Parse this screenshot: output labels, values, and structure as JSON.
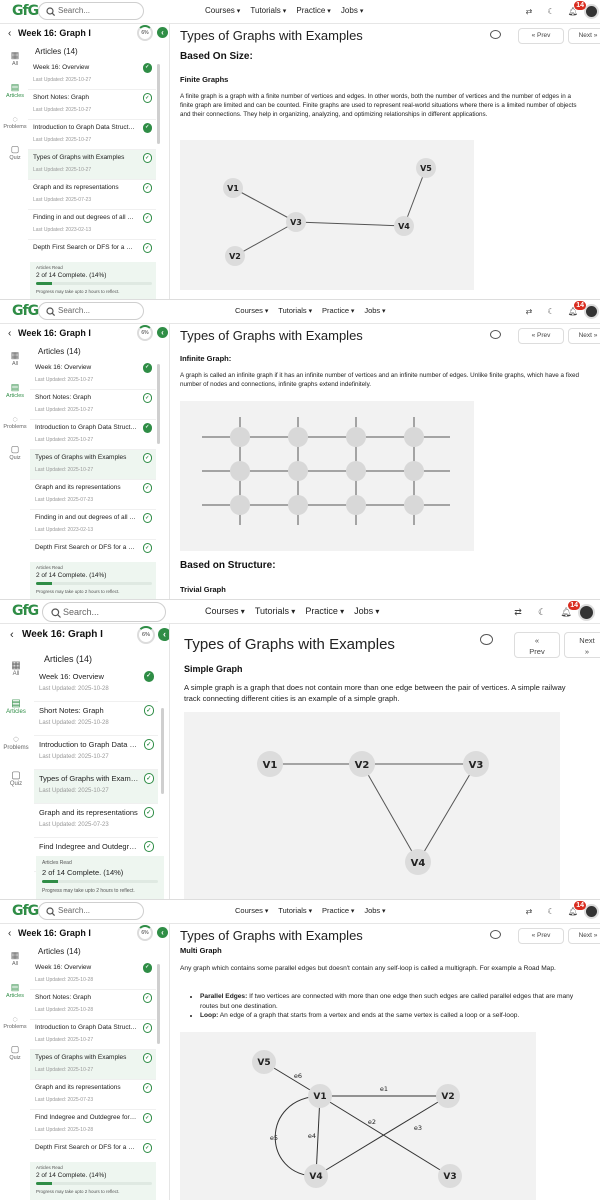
{
  "header": {
    "logo": "GfG",
    "search_placeholder": "Search...",
    "nav": [
      "Courses",
      "Tutorials",
      "Practice",
      "Jobs"
    ],
    "notif_count": "14"
  },
  "sidebar": {
    "week_title": "Week 16: Graph I",
    "percent": "6%",
    "rail": [
      "All",
      "Articles",
      "Problems",
      "Quiz"
    ],
    "articles_heading": "Articles (14)",
    "progress_label": "Articles Read",
    "progress_value": "2 of 14 Complete. (14%)",
    "progress_fraction": 0.14,
    "progress_note": "Progress may take upto 2 hours to reflect."
  },
  "panels": [
    {
      "articles": [
        {
          "title": "Week 16: Overview",
          "updated": "Last Updated: 2025-10-27",
          "done": true,
          "selected": false
        },
        {
          "title": "Short Notes: Graph",
          "updated": "Last Updated: 2025-10-27",
          "done": false,
          "selected": false
        },
        {
          "title": "Introduction to Graph Data Structure",
          "updated": "Last Updated: 2025-10-27",
          "done": true,
          "selected": false
        },
        {
          "title": "Types of Graphs with Examples",
          "updated": "Last Updated: 2025-10-27",
          "done": false,
          "selected": true
        },
        {
          "title": "Graph and its representations",
          "updated": "Last Updated: 2025-07-23",
          "done": false,
          "selected": false
        },
        {
          "title": "Finding in and out degrees of all ver...",
          "updated": "Last Updated: 2023-02-13",
          "done": false,
          "selected": false
        },
        {
          "title": "Depth First Search or DFS for a Gra...",
          "updated": "",
          "done": false,
          "selected": false
        }
      ],
      "page_title": "Types of Graphs with Examples",
      "prev": "Prev",
      "next": "Next",
      "heading": "Based On Size:",
      "subheading": "Finite Graphs",
      "paragraph": "A finite graph is a graph with a finite number of vertices and edges. In other words, both the number of vertices and the number of edges in a finite graph are limited and can be counted. Finite graphs are used to represent real-world situations where there is a limited number of objects and their connections. They help in organizing, analyzing, and optimizing relationships in different applications.",
      "labels": [
        "V1",
        "V2",
        "V3",
        "V4",
        "V5"
      ]
    },
    {
      "articles": [
        {
          "title": "Week 16: Overview",
          "updated": "Last Updated: 2025-10-27",
          "done": true,
          "selected": false
        },
        {
          "title": "Short Notes: Graph",
          "updated": "Last Updated: 2025-10-27",
          "done": false,
          "selected": false
        },
        {
          "title": "Introduction to Graph Data Structure",
          "updated": "Last Updated: 2025-10-27",
          "done": true,
          "selected": false
        },
        {
          "title": "Types of Graphs with Examples",
          "updated": "Last Updated: 2025-10-27",
          "done": false,
          "selected": true
        },
        {
          "title": "Graph and its representations",
          "updated": "Last Updated: 2025-07-23",
          "done": false,
          "selected": false
        },
        {
          "title": "Finding in and out degrees of all ver...",
          "updated": "Last Updated: 2023-02-13",
          "done": false,
          "selected": false
        },
        {
          "title": "Depth First Search or DFS for a Gra...",
          "updated": "",
          "done": false,
          "selected": false
        }
      ],
      "page_title": "Types of Graphs with Examples",
      "prev": "Prev",
      "next": "Next",
      "subheading": "Infinite Graph:",
      "paragraph": "A graph is called an infinite graph if it has an infinite number of vertices and an infinite number of edges. Unlike finite graphs, which have a fixed number of nodes and connections, infinite graphs extend indefinitely.",
      "heading2": "Based on Structure:",
      "subheading2": "Trivial Graph"
    },
    {
      "articles": [
        {
          "title": "Week 16: Overview",
          "updated": "Last Updated: 2025-10-28",
          "done": true,
          "selected": false
        },
        {
          "title": "Short Notes: Graph",
          "updated": "Last Updated: 2025-10-28",
          "done": false,
          "selected": false
        },
        {
          "title": "Introduction to Graph Data Str...",
          "updated": "Last Updated: 2025-10-27",
          "done": false,
          "selected": false
        },
        {
          "title": "Types of Graphs with Examples",
          "updated": "Last Updated: 2025-10-27",
          "done": false,
          "selected": true
        },
        {
          "title": "Graph and its representations",
          "updated": "Last Updated: 2025-07-23",
          "done": false,
          "selected": false
        },
        {
          "title": "Find Indegree and Outdegree ...",
          "updated": "",
          "done": false,
          "selected": false
        }
      ],
      "page_title": "Types of Graphs with Examples",
      "prev": "Prev",
      "next": "Next",
      "subheading": "Simple Graph",
      "paragraph": "A simple graph is a graph that does not contain more than one edge between the pair of vertices. A simple railway track connecting different cities is an example of a simple graph.",
      "labels": [
        "V1",
        "V2",
        "V3",
        "V4"
      ]
    },
    {
      "articles": [
        {
          "title": "Week 16: Overview",
          "updated": "Last Updated: 2025-10-28",
          "done": true,
          "selected": false
        },
        {
          "title": "Short Notes: Graph",
          "updated": "Last Updated: 2025-10-28",
          "done": false,
          "selected": false
        },
        {
          "title": "Introduction to Graph Data Structure",
          "updated": "Last Updated: 2025-10-27",
          "done": false,
          "selected": false
        },
        {
          "title": "Types of Graphs with Examples",
          "updated": "Last Updated: 2025-10-27",
          "done": false,
          "selected": true
        },
        {
          "title": "Graph and its representations",
          "updated": "Last Updated: 2025-07-23",
          "done": false,
          "selected": false
        },
        {
          "title": "Find Indegree and Outdegree for all...",
          "updated": "Last Updated: 2025-10-28",
          "done": false,
          "selected": false
        },
        {
          "title": "Depth First Search or DFS for a Gra...",
          "updated": "",
          "done": false,
          "selected": false
        }
      ],
      "page_title": "Types of Graphs with Examples",
      "prev": "Prev",
      "next": "Next",
      "subheading": "Multi Graph",
      "paragraph": "Any graph which contains some parallel edges but doesn't contain any self-loop is called a multigraph. For example a Road Map.",
      "bullets": [
        {
          "term": "Parallel Edges:",
          "text": "If two vertices are connected with more than one edge then such edges are called parallel edges that are many routes but one destination."
        },
        {
          "term": "Loop:",
          "text": "An edge of a graph that starts from a vertex and ends at the same vertex is called a loop or a self-loop."
        }
      ],
      "labels": [
        "V1",
        "V2",
        "V3",
        "V4",
        "V5"
      ],
      "edge_labels": [
        "e1",
        "e2",
        "e3",
        "e4",
        "e5",
        "e6"
      ]
    }
  ]
}
